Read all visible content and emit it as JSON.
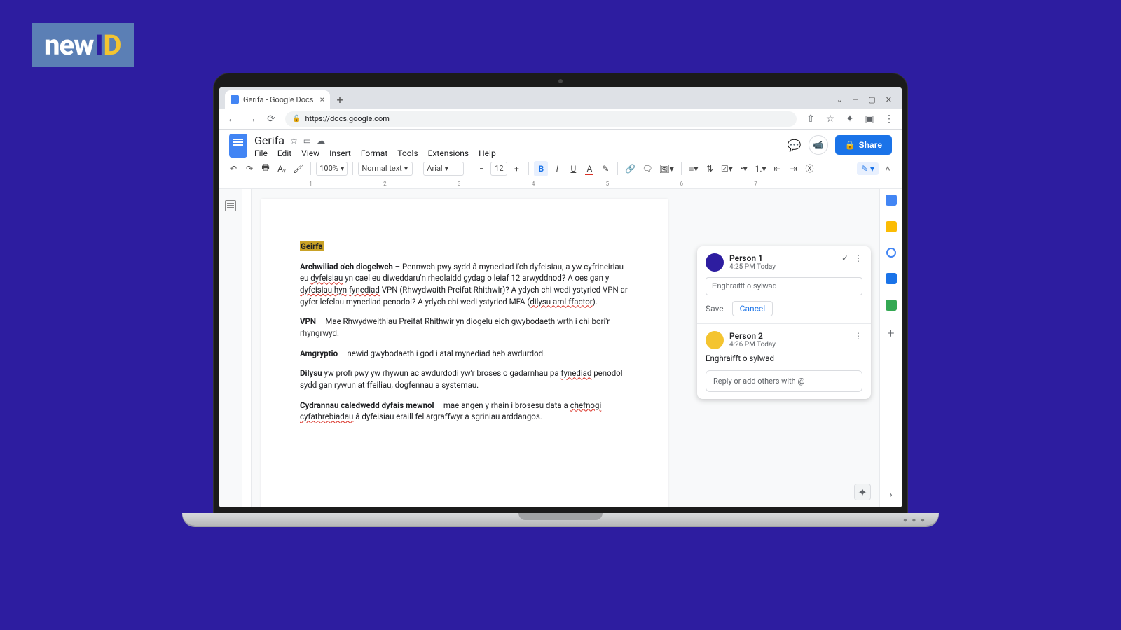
{
  "logo": {
    "new": "new",
    "i": "I",
    "d": "D"
  },
  "browser": {
    "tab_title": "Gerifa - Google Docs",
    "url": "https://docs.google.com",
    "win": {
      "min": "—",
      "max": "▢",
      "close": "✕",
      "chevron": "⌄"
    }
  },
  "doc": {
    "title": "Gerifa",
    "menus": [
      "File",
      "Edit",
      "View",
      "Insert",
      "Format",
      "Tools",
      "Extensions",
      "Help"
    ],
    "share": "Share"
  },
  "toolbar": {
    "zoom": "100%",
    "style": "Normal text",
    "font": "Arial",
    "size": "12"
  },
  "content": {
    "heading": "Geirfa",
    "p1_b": "Archwiliad o'ch diogelwch",
    "p1": " – Pennwch pwy sydd â mynediad i'ch dyfeisiau, a yw cyfrineiriau eu ",
    "p1_s1": "dyfeisiau",
    "p1_2": " yn cael eu diweddaru'n rheolaidd gydag o leiaf 12 arwyddnod? A oes gan y ",
    "p1_s2": "dyfeisiau hyn",
    "p1_3": " ",
    "p1_s3": "fynediad",
    "p1_4": " VPN (Rhwydwaith Preifat Rhithwir)? A ydych chi wedi ystyried VPN ar gyfer lefelau mynediad penodol? A ydych chi wedi ystyried MFA (",
    "p1_s4": "dilysu aml-ffactor",
    "p1_5": ").",
    "p2_b": "VPN",
    "p2": " – Mae Rhwydweithiau Preifat Rhithwir yn diogelu eich gwybodaeth wrth i chi bori'r rhyngrwyd.",
    "p3_b": "Amgryptio",
    "p3": " – newid gwybodaeth i god i atal mynediad heb awdurdod.",
    "p4_b": "Dilysu",
    "p4_1": " yw profi pwy yw rhywun ac awdurdodi yw'r broses o gadarnhau pa ",
    "p4_s1": "fynediad",
    "p4_2": " penodol sydd gan rywun at ffeiliau, dogfennau a systemau.",
    "p5_b": "Cydrannau caledwedd dyfais mewnol",
    "p5_1": " – mae angen y rhain i brosesu data a ",
    "p5_s1": "chefnogi cyfathrebiadau",
    "p5_2": " â dyfeisiau eraill fel argraffwyr a sgriniau arddangos."
  },
  "comments": {
    "p1_name": "Person 1",
    "p1_time": "4:25 PM Today",
    "input_placeholder": "Enghraifft o sylwad",
    "save": "Save",
    "cancel": "Cancel",
    "p2_name": "Person 2",
    "p2_time": "4:26 PM Today",
    "p2_text": "Enghraifft o sylwad",
    "reply_placeholder": "Reply or add others with @"
  }
}
